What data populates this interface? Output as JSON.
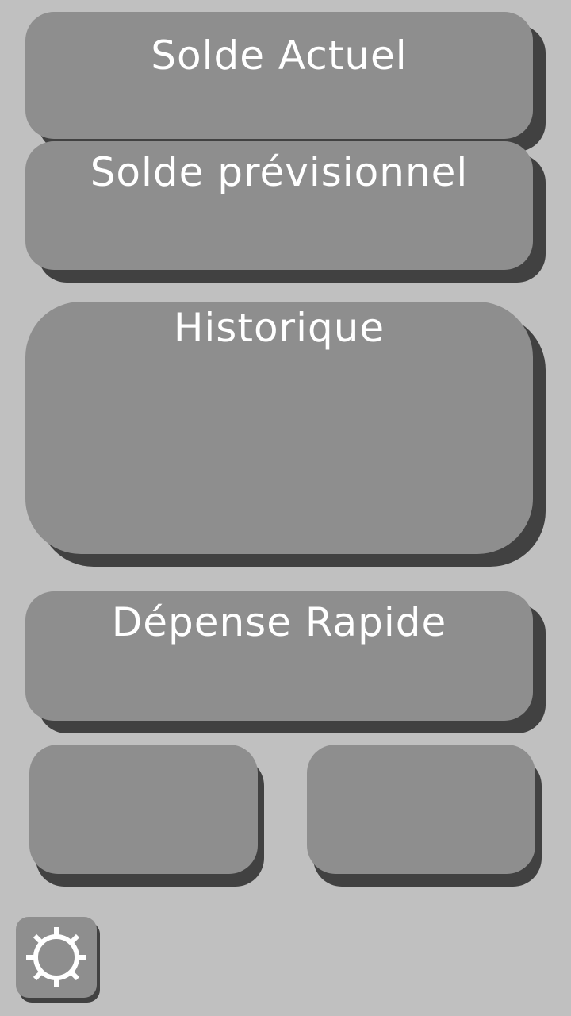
{
  "cards": {
    "solde_actuel": {
      "title": "Solde Actuel"
    },
    "solde_previsionnel": {
      "title": "Solde prévisionnel"
    },
    "historique": {
      "title": "Historique"
    },
    "depense_rapide": {
      "title": "Dépense Rapide"
    }
  },
  "settings": {
    "icon": "gear-icon"
  },
  "colors": {
    "background": "#c0c0c0",
    "card": "#8e8e8e",
    "shadow": "#414141",
    "text": "#ffffff"
  }
}
